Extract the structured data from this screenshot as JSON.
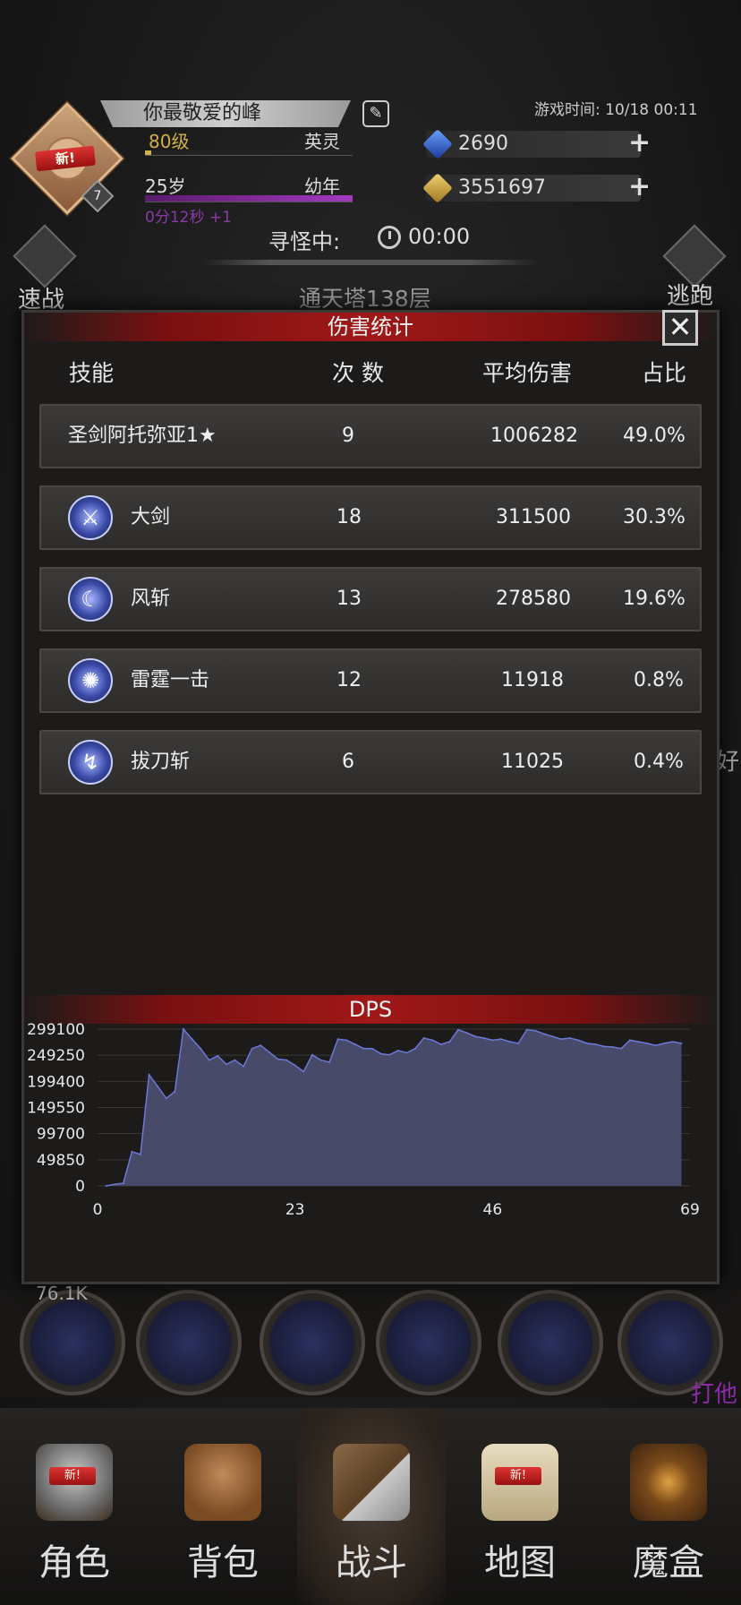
{
  "header": {
    "new_label": "新!",
    "player_level_badge": "7",
    "player_name": "你最敬爱的峰",
    "level_text": "80级",
    "rank_text": "英灵",
    "age_text": "25岁",
    "stage_text": "幼年",
    "age_timer": "0分12秒 +1",
    "game_time": "游戏时间: 10/18 00:11",
    "gems": "2690",
    "gold": "3551697",
    "search_label": "寻怪中:",
    "search_time": "00:00",
    "quick_battle": "速战",
    "flee": "逃跑",
    "floor": "通天塔138层"
  },
  "panel": {
    "title": "伤害统计",
    "close_label": "✕",
    "columns": [
      "技能",
      "次 数",
      "平均伤害",
      "占比"
    ],
    "rows": [
      {
        "name": "圣剑阿托弥亚1★",
        "count": "9",
        "avg": "1006282",
        "pct": "49.0%",
        "icon": null
      },
      {
        "name": "大剑",
        "count": "18",
        "avg": "311500",
        "pct": "30.3%",
        "icon": "greatsword-skill-icon"
      },
      {
        "name": "风斩",
        "count": "13",
        "avg": "278580",
        "pct": "19.6%",
        "icon": "wind-slash-skill-icon"
      },
      {
        "name": "雷霆一击",
        "count": "12",
        "avg": "11918",
        "pct": "0.8%",
        "icon": "thunder-strike-skill-icon"
      },
      {
        "name": "拔刀斩",
        "count": "6",
        "avg": "11025",
        "pct": "0.4%",
        "icon": "iaido-slash-skill-icon"
      }
    ]
  },
  "chart_data": {
    "type": "area",
    "title": "DPS",
    "xlabel": "",
    "ylabel": "",
    "xlim": [
      0,
      69
    ],
    "ylim": [
      0,
      299100
    ],
    "x_ticks": [
      "0",
      "23",
      "46",
      "69"
    ],
    "y_ticks": [
      "299100",
      "249250",
      "199400",
      "149550",
      "99700",
      "49850",
      "0"
    ],
    "grid": true,
    "color": "#484a6a",
    "line_color": "#6a78d8",
    "x": [
      1,
      2,
      3,
      4,
      5,
      6,
      7,
      8,
      9,
      10,
      11,
      12,
      13,
      14,
      15,
      16,
      17,
      18,
      19,
      20,
      21,
      22,
      23,
      24,
      25,
      26,
      27,
      28,
      29,
      30,
      31,
      32,
      33,
      34,
      35,
      36,
      37,
      38,
      39,
      40,
      41,
      42,
      43,
      44,
      45,
      46,
      47,
      48,
      49,
      50,
      51,
      52,
      53,
      54,
      55,
      56,
      57,
      58,
      59,
      60,
      61,
      62,
      63,
      64,
      65,
      66,
      67,
      68
    ],
    "values": [
      0,
      3000,
      5000,
      65000,
      60000,
      212000,
      190000,
      167000,
      180000,
      299000,
      280000,
      262000,
      240000,
      248000,
      232000,
      240000,
      228000,
      262000,
      268000,
      255000,
      242000,
      240000,
      230000,
      218000,
      250000,
      240000,
      236000,
      280000,
      278000,
      270000,
      262000,
      262000,
      252000,
      250000,
      258000,
      254000,
      262000,
      282000,
      278000,
      270000,
      275000,
      298000,
      292000,
      285000,
      282000,
      278000,
      280000,
      275000,
      272000,
      298000,
      296000,
      290000,
      285000,
      280000,
      282000,
      278000,
      272000,
      270000,
      266000,
      265000,
      262000,
      278000,
      275000,
      272000,
      268000,
      272000,
      275000,
      272000
    ]
  },
  "background": {
    "hp_text": "76.1K",
    "right_text": "好",
    "hit_text": "打他"
  },
  "nav": {
    "items": [
      {
        "label": "角色",
        "icon": "helmet-icon",
        "new": "新!"
      },
      {
        "label": "背包",
        "icon": "backpack-icon",
        "new": ""
      },
      {
        "label": "战斗",
        "icon": "shield-sword-icon",
        "new": ""
      },
      {
        "label": "地图",
        "icon": "scroll-map-icon",
        "new": "新!"
      },
      {
        "label": "魔盒",
        "icon": "magic-box-icon",
        "new": ""
      }
    ]
  }
}
